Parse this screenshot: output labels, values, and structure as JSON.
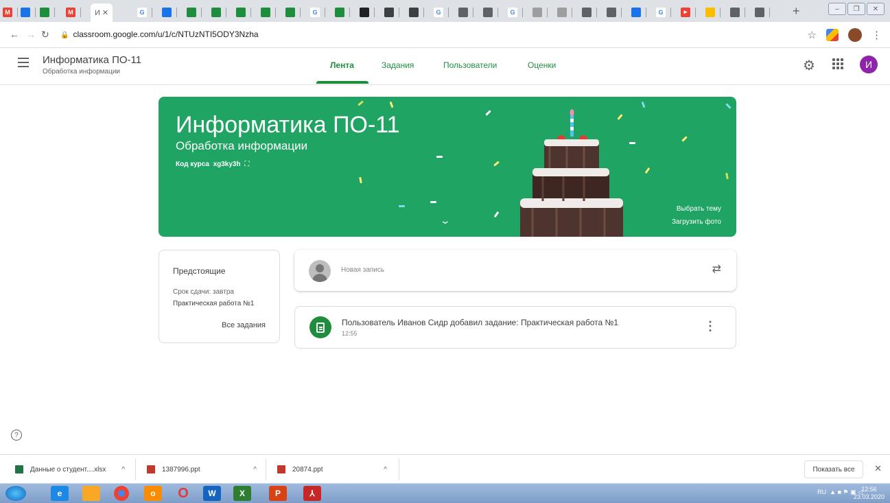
{
  "browser": {
    "active_tab_label": "И",
    "url": "classroom.google.com/u/1/c/NTUzNTI5ODY3Nzha",
    "tab_labels": [
      "М",
      "М",
      "G",
      "G",
      "G",
      "G",
      "G"
    ]
  },
  "header": {
    "course_title": "Информатика ПО-11",
    "course_subtitle": "Обработка информации",
    "tabs": [
      {
        "label": "Лента"
      },
      {
        "label": "Задания"
      },
      {
        "label": "Пользователи"
      },
      {
        "label": "Оценки"
      }
    ],
    "avatar_letter": "И"
  },
  "banner": {
    "title": "Информатика ПО-11",
    "subtitle": "Обработка информации",
    "course_code_label": "Код курса",
    "course_code": "xg3ky3h",
    "select_theme": "Выбрать тему",
    "upload_photo": "Загрузить фото"
  },
  "upcoming": {
    "title": "Предстоящие",
    "due": "Срок сдачи: завтра",
    "task": "Практическая работа №1",
    "all_link": "Все задания"
  },
  "post": {
    "placeholder": "Новая запись"
  },
  "stream": {
    "text": "Пользователь Иванов Сидр добавил задание: Практическая работа №1",
    "time": "12:55"
  },
  "downloads": {
    "items": [
      "Данные о студент....xlsx",
      "1387996.ppt",
      "20874.ppt"
    ],
    "show_all": "Показать все"
  },
  "taskbar": {
    "lang": "RU",
    "time": "12:56",
    "date": "23.03.2020"
  },
  "colors": {
    "accent": "#1e8e3e",
    "banner": "#1fa463",
    "avatar": "#8e24aa"
  }
}
